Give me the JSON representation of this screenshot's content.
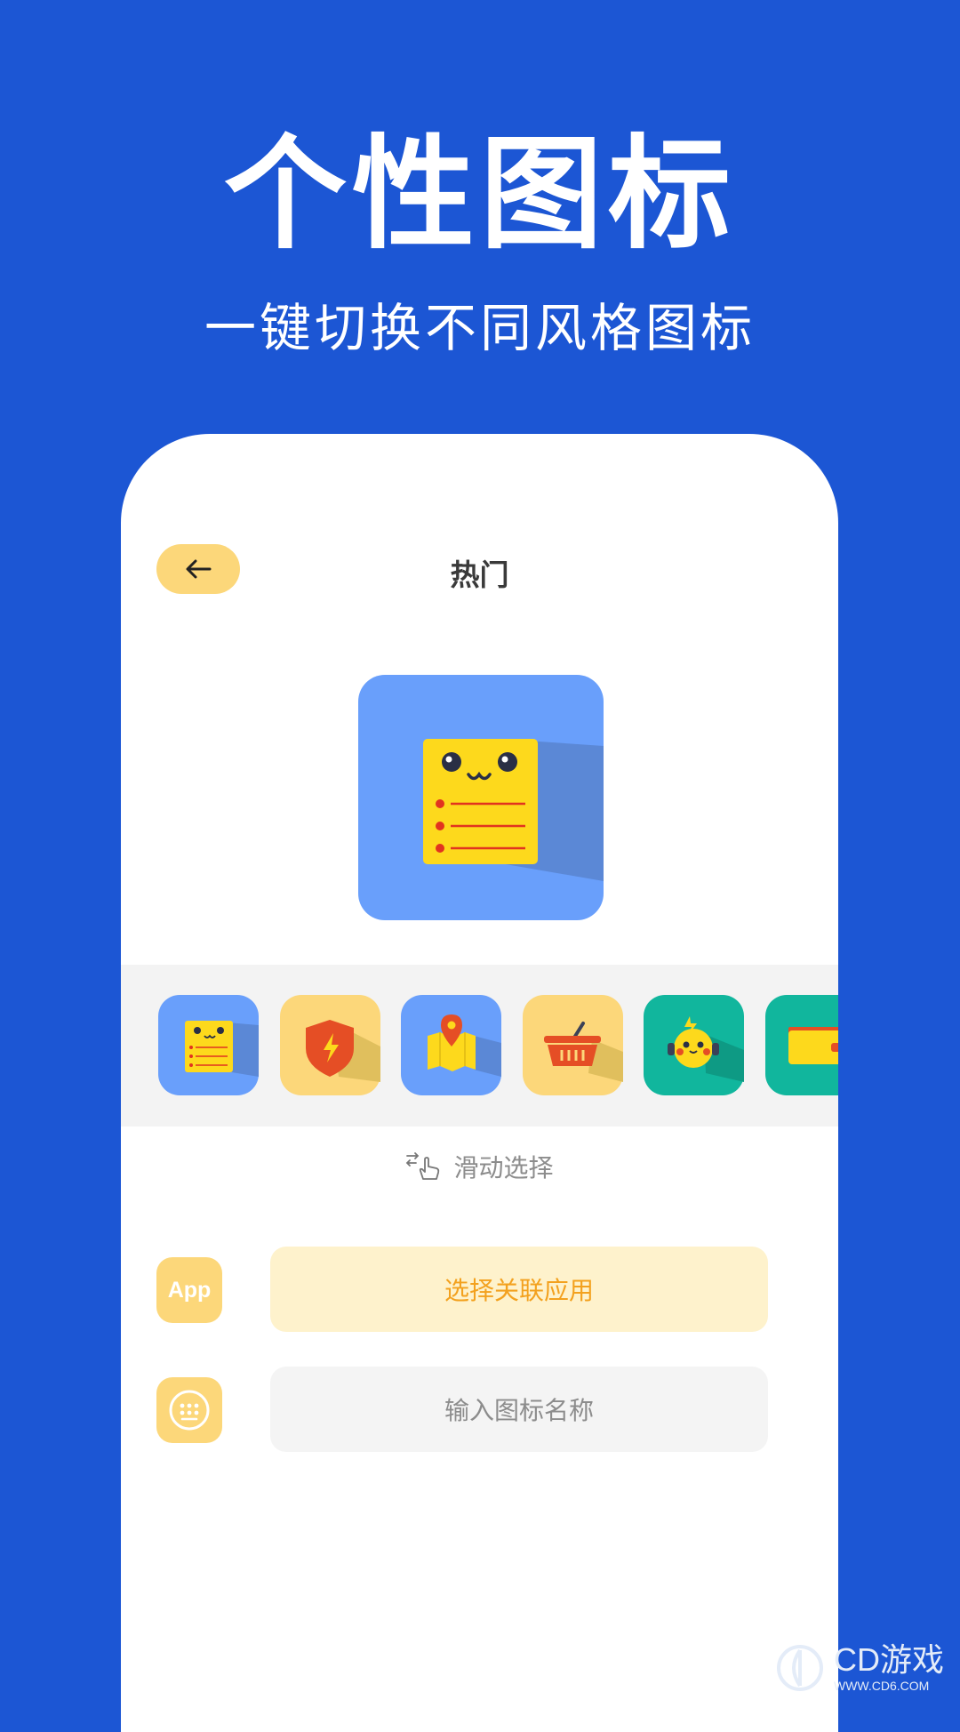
{
  "banner": {
    "title": "个性图标",
    "subtitle": "一键切换不同风格图标"
  },
  "header": {
    "back_icon": "arrow-left-icon",
    "title": "热门"
  },
  "preview": {
    "icon": "notepad-face-icon",
    "bg_color": "#699ffb"
  },
  "icon_strip": {
    "items": [
      {
        "icon": "notepad-face-icon",
        "bg": "#699ffb"
      },
      {
        "icon": "shield-bolt-icon",
        "bg": "#fcd77a"
      },
      {
        "icon": "map-pin-icon",
        "bg": "#699ffb"
      },
      {
        "icon": "shopping-basket-icon",
        "bg": "#fcd77a"
      },
      {
        "icon": "pikachu-headphones-icon",
        "bg": "#11b69d"
      },
      {
        "icon": "wallet-icon",
        "bg": "#11b69d"
      }
    ]
  },
  "hint": {
    "icon": "swipe-hand-icon",
    "text": "滑动选择"
  },
  "form": {
    "app_badge": "App",
    "app_button": "选择关联应用",
    "name_icon": "keyboard-icon",
    "name_placeholder": "输入图标名称"
  },
  "watermark": {
    "brand": "CD游戏",
    "url": "WWW.CD6.COM"
  },
  "colors": {
    "background": "#1c56d4",
    "accent_yellow": "#fcd77a",
    "accent_orange": "#f3a11e"
  }
}
